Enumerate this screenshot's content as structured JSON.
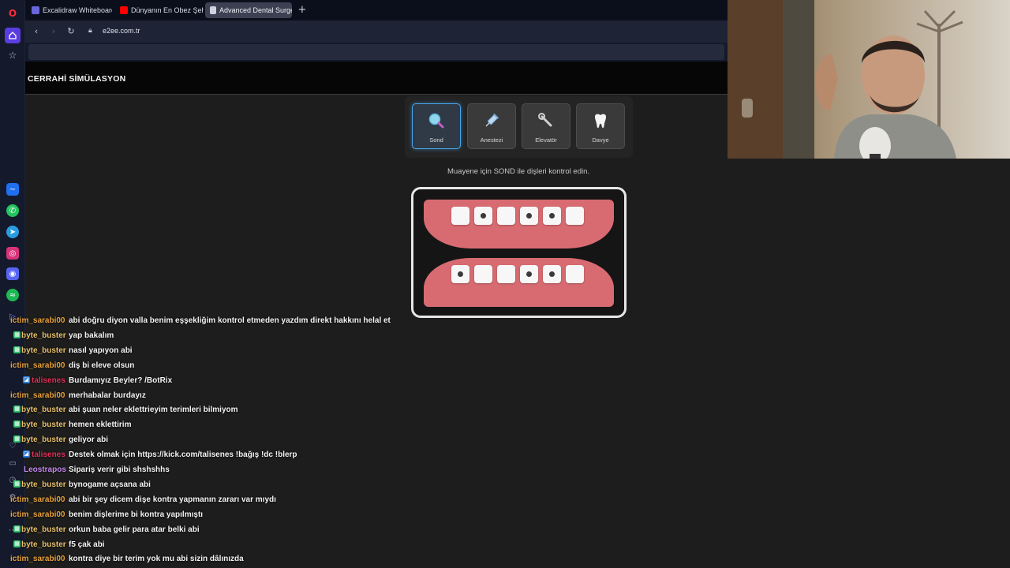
{
  "browser": {
    "tabs": [
      {
        "label": "Excalidraw Whiteboard",
        "favicon": "excalidraw-icon",
        "active": false
      },
      {
        "label": "Dünyanın En Obez Şehrind",
        "favicon": "youtube-icon",
        "active": false
      },
      {
        "label": "Advanced Dental Surgery",
        "favicon": "document-icon",
        "active": true
      }
    ],
    "new_tab": "+",
    "url": "e2ee.com.tr"
  },
  "page": {
    "title": "CERRAHİ SİMÜLASYON",
    "tools": [
      {
        "label": "Sond",
        "icon": "magnifier-icon",
        "selected": true
      },
      {
        "label": "Anestezi",
        "icon": "syringe-icon",
        "selected": false
      },
      {
        "label": "Elevatör",
        "icon": "wrench-icon",
        "selected": false
      },
      {
        "label": "Davye",
        "icon": "tooth-icon",
        "selected": false
      }
    ],
    "instruction": "Muayene için SOND ile dişleri kontrol edin.",
    "upper_teeth_cavities": [
      false,
      true,
      false,
      true,
      true,
      false
    ],
    "lower_teeth_cavities": [
      true,
      false,
      false,
      true,
      true,
      false
    ]
  },
  "chat": [
    {
      "user": "ictim_sarabi00",
      "color": "#e8a23a",
      "badge": "",
      "message": "abi doğru diyon valla benim eşşekliğim kontrol etmeden yazdım direkt hakkını helal et"
    },
    {
      "user": "byte_buster",
      "color": "#e8c06a",
      "badge": "green",
      "message": "yap bakalım"
    },
    {
      "user": "byte_buster",
      "color": "#e8c06a",
      "badge": "green",
      "message": "nasıl yapıyon abi"
    },
    {
      "user": "ictim_sarabi00",
      "color": "#e8a23a",
      "badge": "",
      "message": "diş bi eleve olsun"
    },
    {
      "user": "talisenes",
      "color": "#e0305a",
      "badge": "blue",
      "message": "Burdamıyız Beyler? /BotRix"
    },
    {
      "user": "ictim_sarabi00",
      "color": "#e8a23a",
      "badge": "",
      "message": "merhabalar burdayız"
    },
    {
      "user": "byte_buster",
      "color": "#e8c06a",
      "badge": "green",
      "message": "abi şuan neler eklettrieyim terimleri bilmiyom"
    },
    {
      "user": "byte_buster",
      "color": "#e8c06a",
      "badge": "green",
      "message": "hemen eklettirim"
    },
    {
      "user": "byte_buster",
      "color": "#e8c06a",
      "badge": "green",
      "message": "geliyor abi"
    },
    {
      "user": "talisenes",
      "color": "#e0305a",
      "badge": "blue",
      "message": "Destek olmak için https://kick.com/talisenes !bağış !dc !blerp"
    },
    {
      "user": "Leostrapos",
      "color": "#c58af0",
      "badge": "",
      "message": "Sipariş verir gibi shshshhs"
    },
    {
      "user": "byte_buster",
      "color": "#e8c06a",
      "badge": "green",
      "message": "bynogame açsana abi"
    },
    {
      "user": "ictim_sarabi00",
      "color": "#e8a23a",
      "badge": "",
      "message": "abi bir şey dicem dişe kontra yapmanın zararı var mıydı"
    },
    {
      "user": "ictim_sarabi00",
      "color": "#e8a23a",
      "badge": "",
      "message": "benim dişlerime bi kontra yapılmıştı"
    },
    {
      "user": "byte_buster",
      "color": "#e8c06a",
      "badge": "green",
      "message": "orkun baba gelir para atar belki abi"
    },
    {
      "user": "byte_buster",
      "color": "#e8c06a",
      "badge": "green",
      "message": "f5 çak abi"
    },
    {
      "user": "ictim_sarabi00",
      "color": "#e8a23a",
      "badge": "",
      "message": "kontra diye bir terim yok mu abi sizin dâlınızda"
    }
  ],
  "sidebar": {
    "items": [
      "opera-logo-icon",
      "home-icon",
      "star-icon",
      "messenger-icon",
      "whatsapp-icon",
      "telegram-icon",
      "instagram-icon",
      "discord-icon",
      "spotify-icon",
      "player-icon",
      "heart-icon",
      "chat-bubble-icon",
      "clock-icon",
      "settings-icon",
      "more-icon"
    ]
  }
}
